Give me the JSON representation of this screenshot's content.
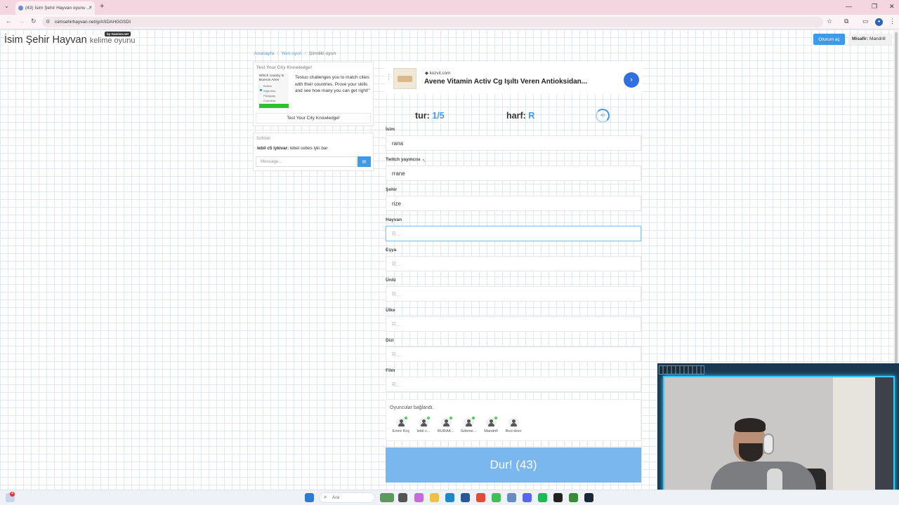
{
  "browser": {
    "tab_title": "(43) İsim Şehir Hayvan oyunu ...",
    "url": "isimsehirhayvan.net/g/ASDAHGGSDI"
  },
  "header": {
    "brand": "İsim Şehir Hayvan",
    "brand_sub": "kelime oyunu",
    "badge": "by Gamiso.net",
    "login_label": "Oturum aç",
    "guest_label": "Misafir:",
    "guest_name": "Mandrill"
  },
  "breadcrumb": {
    "home": "Anasayfa",
    "new_game": "Yeni oyun",
    "current": "Şimdiki oyun"
  },
  "ad_left": {
    "title": "Test Your City Knowledge!",
    "question": "Which country is Buenos Aires",
    "options": [
      "Bolivia",
      "Argentina",
      "Paraguay",
      "Colombia"
    ],
    "description": "Testuo challenges you to match cities with their countries. Prove your skills and see how many you can get right!\"",
    "cta": "Test Your City Knowledge!"
  },
  "chat": {
    "title": "Sohbet",
    "message_user": "lebil c5 iykivar:",
    "message_text": "lebel cebes iyki bar",
    "placeholder": "Message..."
  },
  "ad_top": {
    "source": "kozvit.com",
    "title": "Avene Vitamin Activ Cg Işıltı Veren Antioksidan..."
  },
  "game": {
    "round_label": "tur:",
    "round_value": "1/5",
    "letter_label": "harf:",
    "letter_value": "R",
    "timer": "43"
  },
  "fields": [
    {
      "label": "İsim",
      "value": "rana",
      "placeholder": "R..."
    },
    {
      "label": "Twitch yayıncısı",
      "value": "rrane",
      "placeholder": "R..."
    },
    {
      "label": "Şehir",
      "value": "rize",
      "placeholder": "R..."
    },
    {
      "label": "Hayvan",
      "value": "",
      "placeholder": "R..."
    },
    {
      "label": "Eşya",
      "value": "",
      "placeholder": "R..."
    },
    {
      "label": "Ünlü",
      "value": "",
      "placeholder": "R..."
    },
    {
      "label": "Ülke",
      "value": "",
      "placeholder": "R..."
    },
    {
      "label": "Dizi",
      "value": "",
      "placeholder": "R..."
    },
    {
      "label": "Film",
      "value": "",
      "placeholder": "R..."
    }
  ],
  "players": {
    "title": "Oyuncular bağlandı.",
    "list": [
      "Emre Koç",
      "lebil c...",
      "BURAK...",
      "Gökme...",
      "Mandrill",
      "Red deer"
    ]
  },
  "stop_button": "Dur! (43)",
  "taskbar": {
    "search_placeholder": "Ara",
    "notifications": "4"
  },
  "colors": {
    "accent": "#3d9ae8",
    "stop_button": "#7ab7ee",
    "online": "#4cd04c"
  }
}
